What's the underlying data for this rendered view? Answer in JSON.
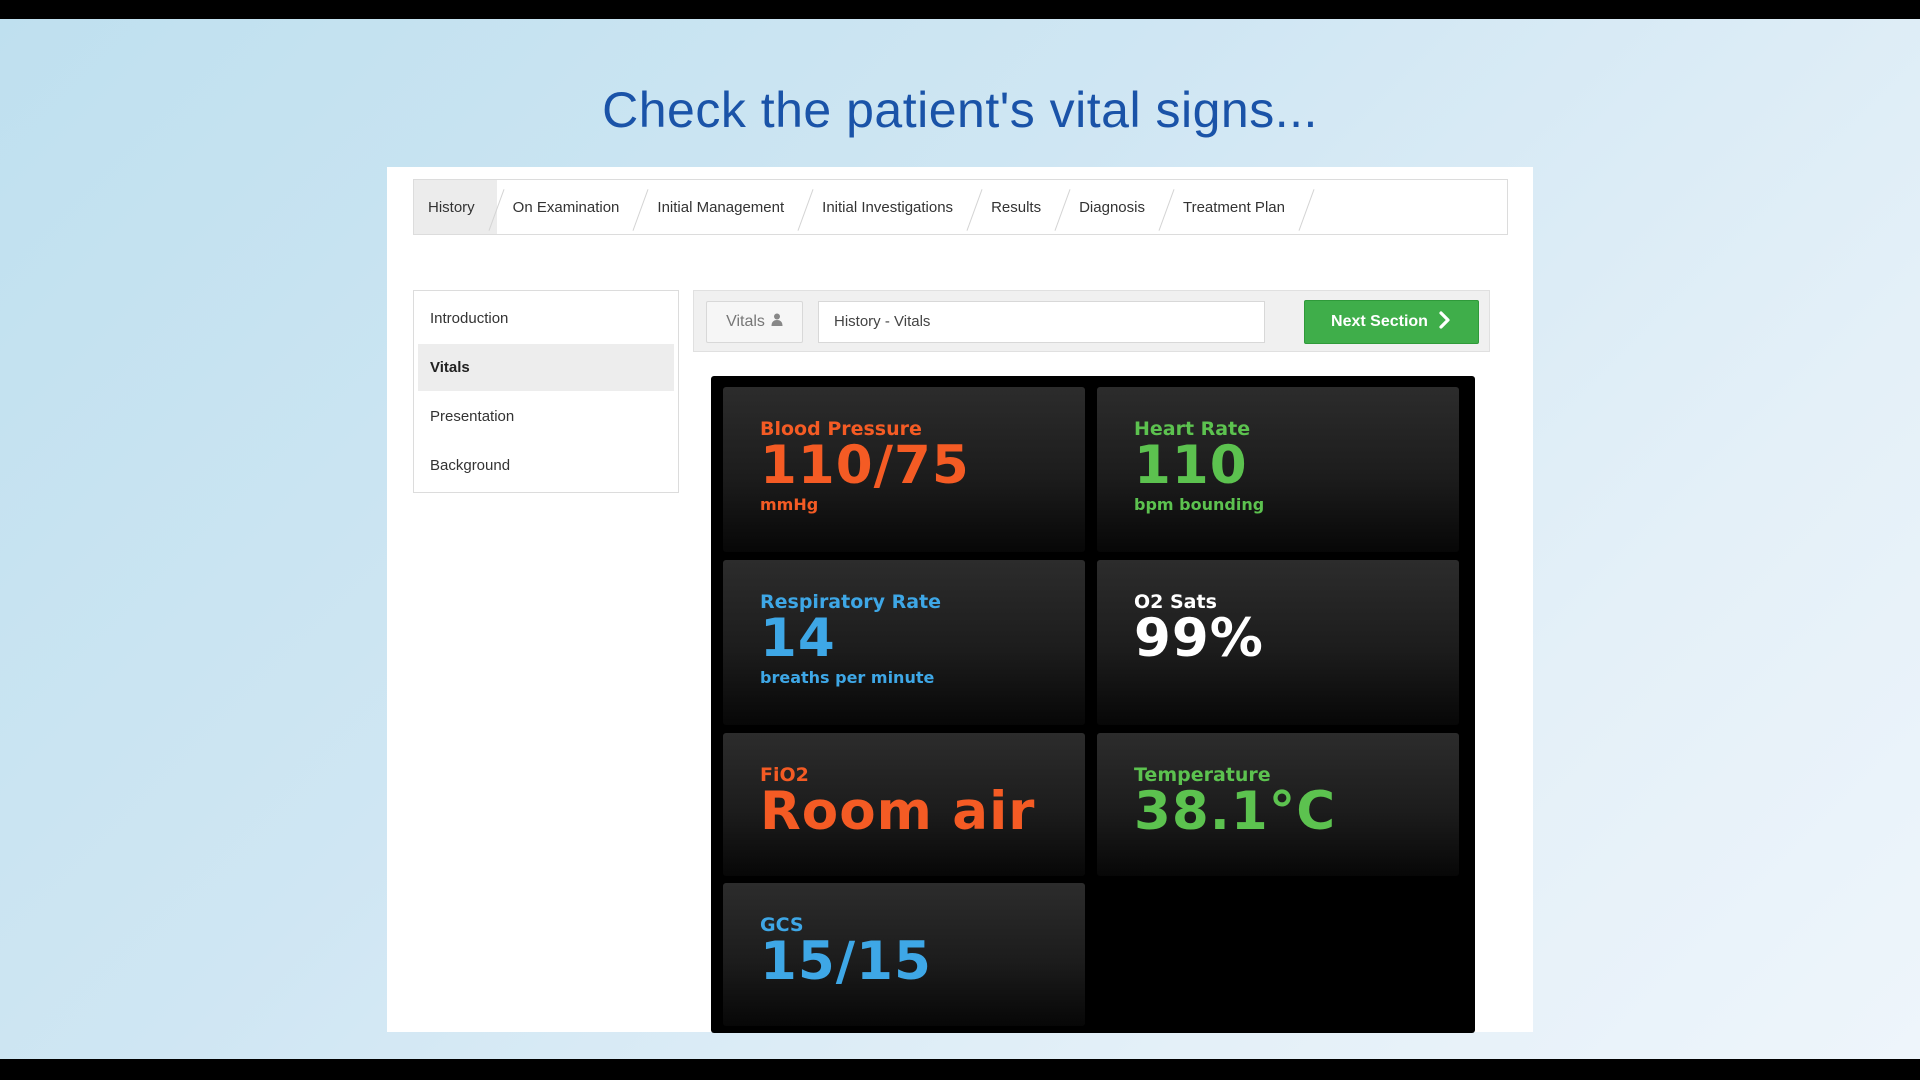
{
  "headline": "Check the patient's vital signs...",
  "tabs": [
    {
      "label": "History",
      "active": true
    },
    {
      "label": "On Examination",
      "active": false
    },
    {
      "label": "Initial Management",
      "active": false
    },
    {
      "label": "Initial Investigations",
      "active": false
    },
    {
      "label": "Results",
      "active": false
    },
    {
      "label": "Diagnosis",
      "active": false
    },
    {
      "label": "Treatment Plan",
      "active": false
    }
  ],
  "sidebar": {
    "items": [
      {
        "label": "Introduction",
        "active": false
      },
      {
        "label": "Vitals",
        "active": true
      },
      {
        "label": "Presentation",
        "active": false
      },
      {
        "label": "Background",
        "active": false
      }
    ]
  },
  "toolbar": {
    "vitals_button": "Vitals",
    "vitals_icon": "user-icon",
    "breadcrumb": "History - Vitals",
    "next_button": "Next Section",
    "next_icon": "chevron-right-icon",
    "next_color": "#3fae4a"
  },
  "vitals": {
    "blood_pressure": {
      "label": "Blood Pressure",
      "value": "110/75",
      "unit": "mmHg",
      "color": "#f45b24"
    },
    "heart_rate": {
      "label": "Heart Rate",
      "value": "110",
      "unit": "bpm bounding",
      "color": "#5cc24f"
    },
    "respiratory_rate": {
      "label": "Respiratory Rate",
      "value": "14",
      "unit": "breaths per minute",
      "color": "#3ea7e6"
    },
    "o2_sats": {
      "label": "O2 Sats",
      "value": "99%",
      "color": "#ffffff"
    },
    "fio2": {
      "label": "FiO2",
      "value": "Room air",
      "color": "#f45b24"
    },
    "temperature": {
      "label": "Temperature",
      "value": "38.1°C",
      "color": "#5cc24f"
    },
    "gcs": {
      "label": "GCS",
      "value": "15/15",
      "color": "#3ea7e6"
    }
  }
}
